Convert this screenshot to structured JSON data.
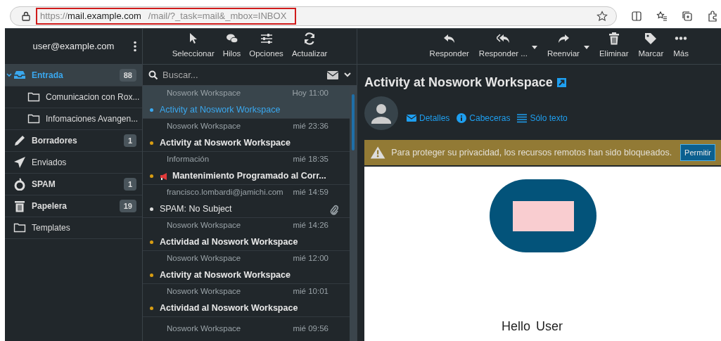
{
  "browser": {
    "url_scheme": "https://",
    "url_host": "mail.example.com",
    "url_path": "/mail/?_task=mail&_mbox=INBOX"
  },
  "account": {
    "email": "user@example.com"
  },
  "list_toolbar": [
    {
      "label": "Seleccionar",
      "kind": "select"
    },
    {
      "label": "Hilos",
      "kind": "threads"
    },
    {
      "label": "Opciones",
      "kind": "options"
    },
    {
      "label": "Actualizar",
      "kind": "refresh"
    }
  ],
  "message_toolbar": [
    {
      "label": "Responder",
      "kind": "reply",
      "dropdown": false
    },
    {
      "label": "Responder ...",
      "kind": "replyall",
      "dropdown": true
    },
    {
      "label": "Reenviar",
      "kind": "forward",
      "dropdown": true
    },
    {
      "label": "Eliminar",
      "kind": "delete",
      "dropdown": false
    },
    {
      "label": "Marcar",
      "kind": "tag",
      "dropdown": false
    },
    {
      "label": "Más",
      "kind": "more",
      "dropdown": false
    }
  ],
  "folders": [
    {
      "label": "Entrada",
      "kind": "inbox",
      "count": "88",
      "bold": true,
      "selected": true,
      "expanded": true,
      "children": [
        {
          "label": "Comunicacion con Rox...",
          "kind": "folder",
          "selected": false
        },
        {
          "label": "Infomaciones Avangen...",
          "kind": "folder",
          "selected": false
        }
      ]
    },
    {
      "label": "Borradores",
      "kind": "drafts",
      "count": "1",
      "bold": true,
      "selected": false
    },
    {
      "label": "Enviados",
      "kind": "sent",
      "bold": false,
      "selected": false
    },
    {
      "label": "SPAM",
      "kind": "spam",
      "count": "1",
      "bold": true,
      "selected": false
    },
    {
      "label": "Papelera",
      "kind": "trash",
      "count": "19",
      "bold": true,
      "selected": false
    },
    {
      "label": "Templates",
      "kind": "folder",
      "bold": false,
      "selected": false
    }
  ],
  "search": {
    "placeholder": "Buscar..."
  },
  "messages": [
    {
      "sender": "Noswork Workspace",
      "date": "Hoy 11:00",
      "subject": "Activity at Noswork Workspace",
      "unread": false,
      "selected": true,
      "megaphone": false,
      "attachment": false
    },
    {
      "sender": "Noswork Workspace",
      "date": "mié 23:36",
      "subject": "Activity at Noswork Workspace",
      "unread": true,
      "selected": false,
      "megaphone": false,
      "attachment": false
    },
    {
      "sender": "Información",
      "date": "mié 18:35",
      "subject": "Mantenimiento Programado al Corr...",
      "unread": true,
      "selected": false,
      "megaphone": true,
      "attachment": false
    },
    {
      "sender": "francisco.lombardi@jamichi.com",
      "date": "mié 14:59",
      "subject": "SPAM: No Subject",
      "unread": false,
      "selected": false,
      "megaphone": false,
      "attachment": true
    },
    {
      "sender": "Noswork Workspace",
      "date": "mié 14:26",
      "subject": "Actividad al Noswork Workspace",
      "unread": true,
      "selected": false,
      "megaphone": false,
      "attachment": false
    },
    {
      "sender": "Noswork Workspace",
      "date": "mié 12:00",
      "subject": "Activity at Noswork Workspace",
      "unread": true,
      "selected": false,
      "megaphone": false,
      "attachment": false
    },
    {
      "sender": "Noswork Workspace",
      "date": "mié 10:01",
      "subject": "Actividad al Noswork Workspace",
      "unread": true,
      "selected": false,
      "megaphone": false,
      "attachment": false
    },
    {
      "sender": "Noswork Workspace",
      "date": "mié 09:56",
      "selected": false
    }
  ],
  "message": {
    "subject": "Activity at Noswork Workspace",
    "links": [
      {
        "label": "Detalles",
        "kind": "details"
      },
      {
        "label": "Cabeceras",
        "kind": "headers"
      },
      {
        "label": "Sólo texto",
        "kind": "plain"
      }
    ],
    "notice": {
      "text": "Para proteger su privacidad, los recursos remotos han sido bloqueados.",
      "button": "Permitir"
    },
    "body": {
      "greeting": "Hello",
      "name": "User"
    }
  }
}
